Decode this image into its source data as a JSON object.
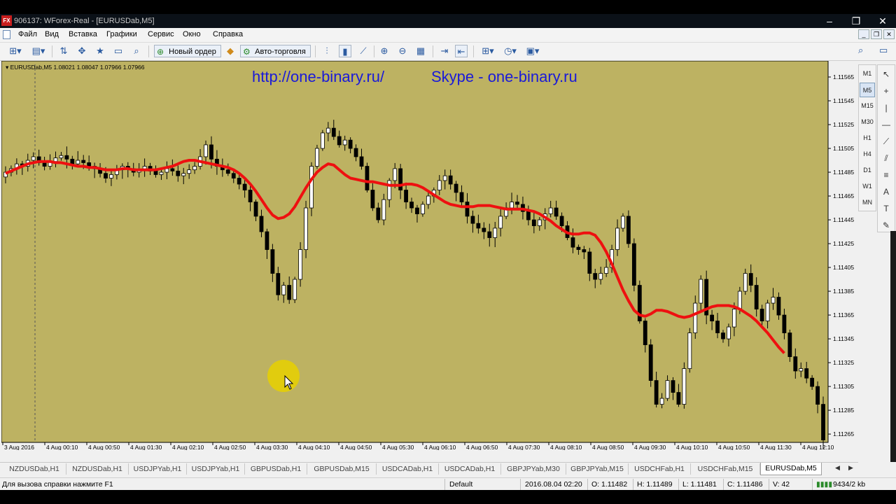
{
  "window": {
    "app_icon": "FX",
    "title": "906137: WForex-Real - [EURUSDab,M5]"
  },
  "menu": {
    "items": [
      "Файл",
      "Вид",
      "Вставка",
      "Графики",
      "Сервис",
      "Окно",
      "Справка"
    ]
  },
  "toolbar": {
    "new_order": "Новый ордер",
    "auto_trading": "Авто-торговля"
  },
  "chart": {
    "header": "EURUSDab,M5  1.08021 1.08047 1.07966 1.07966",
    "watermark_left": "http://one-binary.ru/",
    "watermark_right": "Skype - one-binary.ru",
    "background": "#bdb262",
    "ma_color": "#ee1010"
  },
  "timeframes": [
    "M1",
    "M5",
    "M15",
    "M30",
    "H1",
    "H4",
    "D1",
    "W1",
    "MN"
  ],
  "active_timeframe": "M5",
  "tabs": [
    "NZDUSDab,H1",
    "NZDUSDab,H1",
    "USDJPYab,H1",
    "USDJPYab,H1",
    "GBPUSDab,H1",
    "GBPUSDab,M15",
    "USDCADab,H1",
    "USDCADab,H1",
    "GBPJPYab,M30",
    "GBPJPYab,M15",
    "USDCHFab,H1",
    "USDCHFab,M15",
    "EURUSDab,M5"
  ],
  "active_tab": "EURUSDab,M5",
  "status": {
    "help": "Для вызова справки нажмите F1",
    "profile": "Default",
    "datetime": "2016.08.04 02:20",
    "open": "O: 1.11482",
    "high": "H: 1.11489",
    "low": "L: 1.11481",
    "close": "C: 1.11486",
    "volume": "V: 42",
    "traffic": "9434/2 kb"
  },
  "chart_data": {
    "type": "candlestick",
    "symbol": "EURUSDab",
    "timeframe": "M5",
    "y_ticks": [
      "1.11565",
      "1.11545",
      "1.11525",
      "1.11505",
      "1.11485",
      "1.11465",
      "1.11445",
      "1.11425",
      "1.11405",
      "1.11385",
      "1.11365",
      "1.11345",
      "1.11325",
      "1.11305",
      "1.11285",
      "1.11265"
    ],
    "ylim": [
      1.11258,
      1.11575
    ],
    "x_ticks": [
      "3 Aug 2016",
      "4 Aug 00:10",
      "4 Aug 00:50",
      "4 Aug 01:30",
      "4 Aug 02:10",
      "4 Aug 02:50",
      "4 Aug 03:30",
      "4 Aug 04:10",
      "4 Aug 04:50",
      "4 Aug 05:30",
      "4 Aug 06:10",
      "4 Aug 06:50",
      "4 Aug 07:30",
      "4 Aug 08:10",
      "4 Aug 08:50",
      "4 Aug 09:30",
      "4 Aug 10:10",
      "4 Aug 10:50",
      "4 Aug 11:30",
      "4 Aug 12:10"
    ],
    "closes": [
      1.11485,
      1.11488,
      1.11492,
      1.1149,
      1.11495,
      1.11498,
      1.11493,
      1.1149,
      1.11494,
      1.11497,
      1.11499,
      1.11496,
      1.11492,
      1.11495,
      1.11493,
      1.1149,
      1.11488,
      1.11484,
      1.1148,
      1.11483,
      1.11487,
      1.1149,
      1.11488,
      1.11485,
      1.11487,
      1.1149,
      1.11486,
      1.11483,
      1.11485,
      1.11488,
      1.11486,
      1.11482,
      1.11484,
      1.11487,
      1.1149,
      1.11498,
      1.11508,
      1.11496,
      1.1149,
      1.11487,
      1.11484,
      1.1148,
      1.11475,
      1.1147,
      1.1146,
      1.11448,
      1.11435,
      1.1142,
      1.114,
      1.11382,
      1.1139,
      1.11378,
      1.11395,
      1.1142,
      1.11455,
      1.1149,
      1.11505,
      1.11518,
      1.11522,
      1.11515,
      1.11508,
      1.11512,
      1.11505,
      1.11498,
      1.1149,
      1.1147,
      1.11455,
      1.11445,
      1.11462,
      1.11478,
      1.11488,
      1.1147,
      1.1146,
      1.11455,
      1.1145,
      1.11458,
      1.11465,
      1.1147,
      1.11478,
      1.11482,
      1.11475,
      1.11468,
      1.1146,
      1.11448,
      1.11442,
      1.11438,
      1.11435,
      1.1143,
      1.11438,
      1.11448,
      1.11455,
      1.1146,
      1.11458,
      1.11452,
      1.11445,
      1.1144,
      1.11445,
      1.1145,
      1.11455,
      1.11448,
      1.1144,
      1.1143,
      1.11422,
      1.1142,
      1.11418,
      1.114,
      1.11395,
      1.114,
      1.11405,
      1.1142,
      1.11438,
      1.11448,
      1.11425,
      1.1139,
      1.1136,
      1.1134,
      1.1131,
      1.1129,
      1.11295,
      1.1131,
      1.113,
      1.1129,
      1.1132,
      1.1135,
      1.11375,
      1.11395,
      1.11365,
      1.1136,
      1.1135,
      1.11345,
      1.11355,
      1.1137,
      1.11385,
      1.114,
      1.1139,
      1.1137,
      1.1136,
      1.11375,
      1.1138,
      1.11365,
      1.1135,
      1.1133,
      1.11318,
      1.1132,
      1.11312,
      1.11305,
      1.1129,
      1.1126
    ],
    "moving_average": [
      1.11484,
      1.11486,
      1.11488,
      1.1149,
      1.11492,
      1.11493,
      1.11494,
      1.11494,
      1.11494,
      1.11493,
      1.11493,
      1.11492,
      1.11491,
      1.1149,
      1.1149,
      1.11489,
      1.11489,
      1.11488,
      1.11487,
      1.11487,
      1.11487,
      1.11488,
      1.11488,
      1.11487,
      1.11487,
      1.11487,
      1.11487,
      1.11487,
      1.11488,
      1.11489,
      1.1149,
      1.11492,
      1.11494,
      1.11495,
      1.11495,
      1.11494,
      1.11493,
      1.11492,
      1.11491,
      1.1149,
      1.11489,
      1.11487,
      1.11484,
      1.1148,
      1.11475,
      1.11469,
      1.11462,
      1.11455,
      1.11449,
      1.11446,
      1.11447,
      1.1145,
      1.11456,
      1.11464,
      1.11472,
      1.11479,
      1.11485,
      1.11489,
      1.11492,
      1.11491,
      1.11487,
      1.11483,
      1.1148,
      1.11479,
      1.11478,
      1.11477,
      1.11477,
      1.11476,
      1.11475,
      1.11474,
      1.11474,
      1.11474,
      1.11475,
      1.11475,
      1.11474,
      1.11472,
      1.11469,
      1.11466,
      1.11463,
      1.1146,
      1.11458,
      1.11457,
      1.11456,
      1.11456,
      1.11456,
      1.11457,
      1.11457,
      1.11457,
      1.11456,
      1.11455,
      1.11454,
      1.11454,
      1.11454,
      1.11454,
      1.11453,
      1.11452,
      1.1145,
      1.11447,
      1.11444,
      1.1144,
      1.11437,
      1.11434,
      1.11433,
      1.11433,
      1.11434,
      1.11434,
      1.11432,
      1.11426,
      1.11418,
      1.11408,
      1.11397,
      1.11386,
      1.11377,
      1.11369,
      1.11365,
      1.11364,
      1.11366,
      1.11369,
      1.11369,
      1.11368,
      1.11366,
      1.11364,
      1.11363,
      1.11364,
      1.11366,
      1.11368,
      1.1137,
      1.11372,
      1.11373,
      1.11373,
      1.11373,
      1.11372,
      1.1137,
      1.11367,
      1.11364,
      1.1136,
      1.11355,
      1.1135,
      1.11344,
      1.11338,
      1.11333
    ],
    "ma_color": "#ee1010"
  }
}
